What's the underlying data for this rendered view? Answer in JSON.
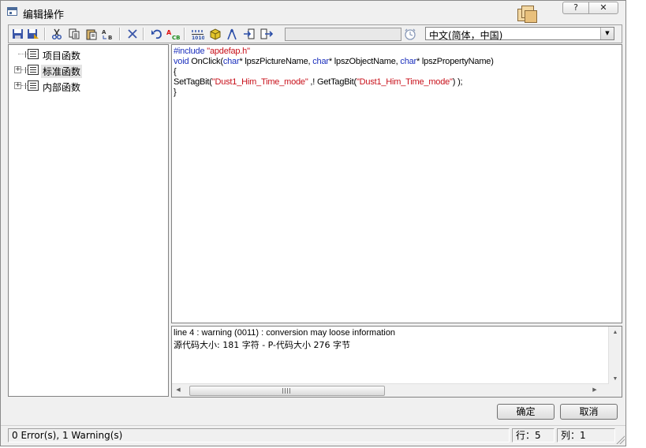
{
  "window": {
    "title": "编辑操作",
    "help_label": "?",
    "close_label": "✕"
  },
  "toolbar": {
    "icons": [
      "save-icon",
      "save-as-icon",
      "cut-icon",
      "copy-icon",
      "paste-icon",
      "replace-icon",
      "delete-icon",
      "undo-icon",
      "compile-icon",
      "format-icon",
      "package-icon",
      "compass-icon",
      "import-icon",
      "export-icon",
      "clock-icon"
    ],
    "language_value": "中文(简体，中国)"
  },
  "tree": {
    "items": [
      {
        "label": "项目函数",
        "expandable": false
      },
      {
        "label": "标准函数",
        "expandable": true,
        "expander": "+"
      },
      {
        "label": "内部函数",
        "expandable": true,
        "expander": "+"
      }
    ]
  },
  "editor": {
    "line1_kw": "#include ",
    "line1_str": "\"apdefap.h\"",
    "line2_kw": "void",
    "line2_a": " OnClick(",
    "line2_b": "char",
    "line2_c": "* lpszPictureName, ",
    "line2_d": "char",
    "line2_e": "* lpszObjectName, ",
    "line2_f": "char",
    "line2_g": "* lpszPropertyName)",
    "line3": "{",
    "line4_a": "SetTagBit(",
    "line4_b": "\"Dust1_Him_Time_mode\"",
    "line4_c": " ,! GetTagBit(",
    "line4_d": "\"Dust1_Him_Time_mode\"",
    "line4_e": ") );",
    "line5": "}"
  },
  "output": {
    "warning": "line 4 : warning (0011) : conversion may loose information",
    "size_info": "源代码大小: 181 字符 - P-代码大小 276 字节"
  },
  "buttons": {
    "ok": "确定",
    "cancel": "取消"
  },
  "status": {
    "errors": "0 Error(s), 1 Warning(s)",
    "row": "行：5",
    "col": "列：1"
  }
}
